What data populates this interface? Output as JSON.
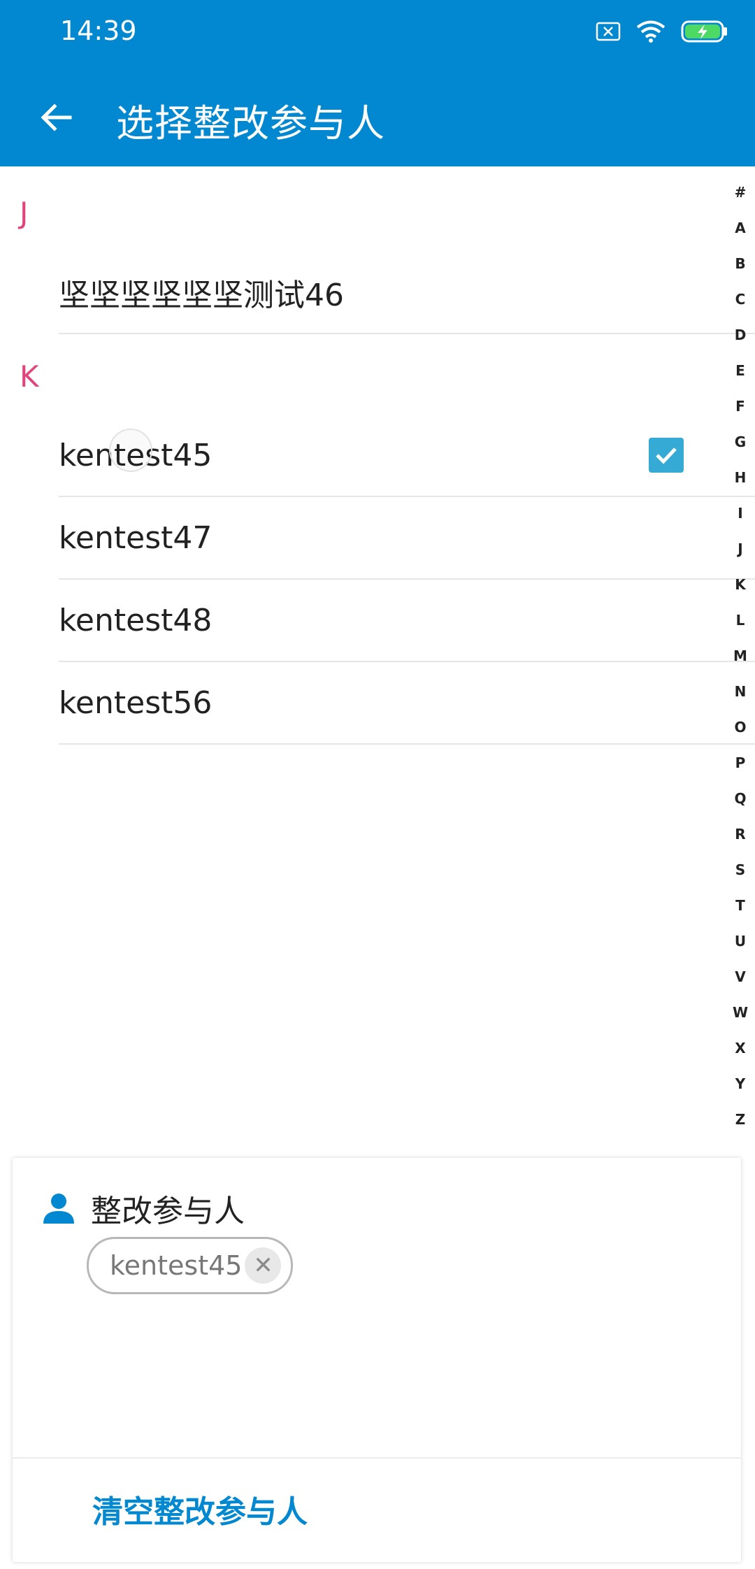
{
  "status_bar": {
    "time": "14:39",
    "icons": [
      "sim-none-icon",
      "wifi-icon",
      "battery-charging-icon"
    ]
  },
  "app_bar": {
    "title": "选择整改参与人",
    "back_icon": "arrow-back-icon"
  },
  "sections": [
    {
      "letter": "J",
      "items": [
        {
          "label": "坚坚坚坚坚坚测试46",
          "checked": false
        }
      ]
    },
    {
      "letter": "K",
      "items": [
        {
          "label": "kentest45",
          "checked": true
        },
        {
          "label": "kentest47",
          "checked": false
        },
        {
          "label": "kentest48",
          "checked": false
        },
        {
          "label": "kentest56",
          "checked": false
        }
      ]
    }
  ],
  "index_letters": [
    "#",
    "A",
    "B",
    "C",
    "D",
    "E",
    "F",
    "G",
    "H",
    "I",
    "J",
    "K",
    "L",
    "M",
    "N",
    "O",
    "P",
    "Q",
    "R",
    "S",
    "T",
    "U",
    "V",
    "W",
    "X",
    "Y",
    "Z"
  ],
  "participants_panel": {
    "title": "整改参与人",
    "chips": [
      {
        "label": "kentest45"
      }
    ],
    "clear_label": "清空整改参与人"
  },
  "colors": {
    "primary": "#0288d1",
    "section_letter": "#e0457b",
    "checkbox": "#35aad4"
  }
}
